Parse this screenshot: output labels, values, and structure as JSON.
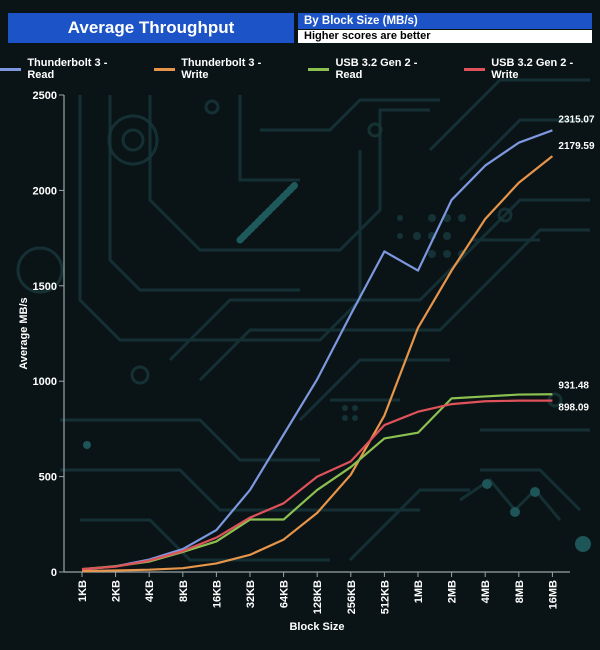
{
  "header": {
    "title": "Average Throughput",
    "subtitle": "By Block Size (MB/s)",
    "note": "Higher scores are better"
  },
  "chart_data": {
    "type": "line",
    "xlabel": "Block Size",
    "ylabel": "Average MB/s",
    "ylim": [
      0,
      2500
    ],
    "yticks": [
      0,
      500,
      1000,
      1500,
      2000,
      2500
    ],
    "categories": [
      "1KB",
      "2KB",
      "4KB",
      "8KB",
      "16KB",
      "32KB",
      "64KB",
      "128KB",
      "256KB",
      "512KB",
      "1MB",
      "2MB",
      "4MB",
      "8MB",
      "16MB"
    ],
    "legend_position": "top",
    "series": [
      {
        "name": "Thunderbolt 3 - Read",
        "color": "#7e98e0",
        "values": [
          12,
          30,
          65,
          120,
          220,
          430,
          720,
          1010,
          1350,
          1680,
          1580,
          1950,
          2130,
          2250,
          2315.07
        ],
        "end_label": "2315.07"
      },
      {
        "name": "Thunderbolt 3 - Write",
        "color": "#e6954a",
        "values": [
          5,
          8,
          12,
          20,
          45,
          90,
          170,
          310,
          510,
          820,
          1280,
          1580,
          1850,
          2040,
          2179.59
        ],
        "end_label": "2179.59"
      },
      {
        "name": "USB 3.2 Gen 2 - Read",
        "color": "#8cc152",
        "values": [
          15,
          30,
          55,
          105,
          160,
          275,
          275,
          430,
          550,
          700,
          730,
          910,
          920,
          930,
          931.48
        ],
        "end_label": "931.48"
      },
      {
        "name": "USB 3.2 Gen 2 - Write",
        "color": "#e0525a",
        "values": [
          15,
          28,
          60,
          110,
          180,
          285,
          360,
          500,
          580,
          770,
          840,
          880,
          895,
          898,
          898.09
        ],
        "end_label": "898.09"
      }
    ]
  }
}
